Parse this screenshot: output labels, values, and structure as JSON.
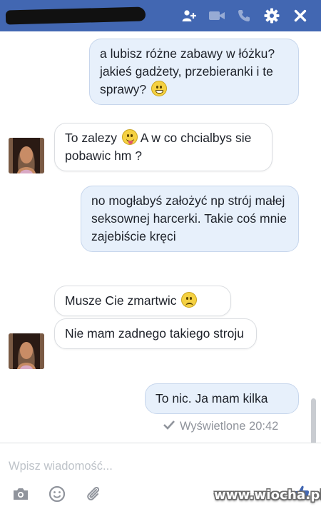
{
  "header": {
    "contact_name": "",
    "icons": [
      "add-friend-icon",
      "video-call-icon",
      "phone-icon",
      "gear-icon",
      "close-icon"
    ],
    "background_color": "#4267b2"
  },
  "messages": [
    {
      "from": "me",
      "text": "a lubisz różne zabawy w łóżku? jakieś gadżety, przebieranki i te sprawy?",
      "emoji": "grin"
    },
    {
      "from": "contact",
      "text_before": "To zalezy",
      "emoji": "tongue",
      "text_after": "A w co chcialbys sie pobawic hm ?"
    },
    {
      "from": "me",
      "text": "no mogłabyś założyć np strój małej seksownej harcerki. Takie coś mnie zajebiście kręci"
    },
    {
      "from": "contact",
      "text": "Musze Cie zmartwic",
      "emoji": "sad"
    },
    {
      "from": "contact",
      "text": "Nie mam zadnego takiego stroju"
    },
    {
      "from": "me",
      "text": "To nic. Ja mam kilka"
    }
  ],
  "status": {
    "seen_text": "Wyświetlone 20:42"
  },
  "composer": {
    "placeholder": "Wpisz wiadomość...",
    "tools": [
      "camera-icon",
      "smiley-icon",
      "paperclip-icon",
      "like-icon"
    ]
  },
  "watermark": "www.wiocha.pl"
}
